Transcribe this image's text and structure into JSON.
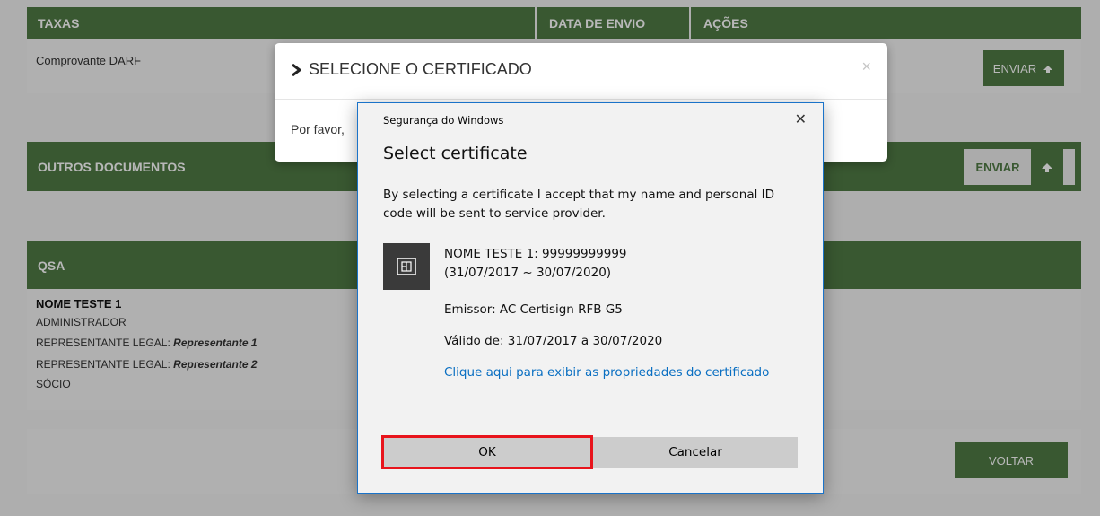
{
  "page": {
    "taxes_header": "TAXAS",
    "date_header": "DATA DE ENVIO",
    "actions_header": "AÇÕES",
    "taxes_row_label": "Comprovante DARF",
    "send_button_1": "ENVIAR",
    "other_docs_header": "OUTROS DOCUMENTOS",
    "send_button_2": "ENVIAR",
    "qsa_header": "QSA",
    "person_name": "NOME TESTE 1",
    "role_1": "ADMINISTRADOR",
    "legal_rep_label": "REPRESENTANTE LEGAL:",
    "legal_rep_value_1": "Representante 1",
    "legal_rep_value_2": "Representante 2",
    "role_partner": "SÓCIO",
    "back_button": "VOLTAR"
  },
  "modal": {
    "title": "SELECIONE O CERTIFICADO",
    "close_symbol": "×",
    "body_text": "Por favor,"
  },
  "windows_dialog": {
    "window_title": "Segurança do Windows",
    "close_symbol": "✕",
    "heading": "Select certificate",
    "description": "By selecting a certificate I accept that my name and personal ID code will be sent to service provider.",
    "cert_name": "NOME TESTE 1:  99999999999",
    "cert_period": "(31/07/2017 ~ 30/07/2020)",
    "issuer": "Emissor: AC Certisign RFB G5",
    "valid": "Válido de: 31/07/2017 a 30/07/2020",
    "properties_link": "Clique aqui para exibir as propriedades do certificado",
    "ok_label": "OK",
    "cancel_label": "Cancelar"
  },
  "colors": {
    "brand_green": "#4f7a45",
    "link_blue": "#0a6fc2",
    "highlight_red": "#e8141c"
  }
}
